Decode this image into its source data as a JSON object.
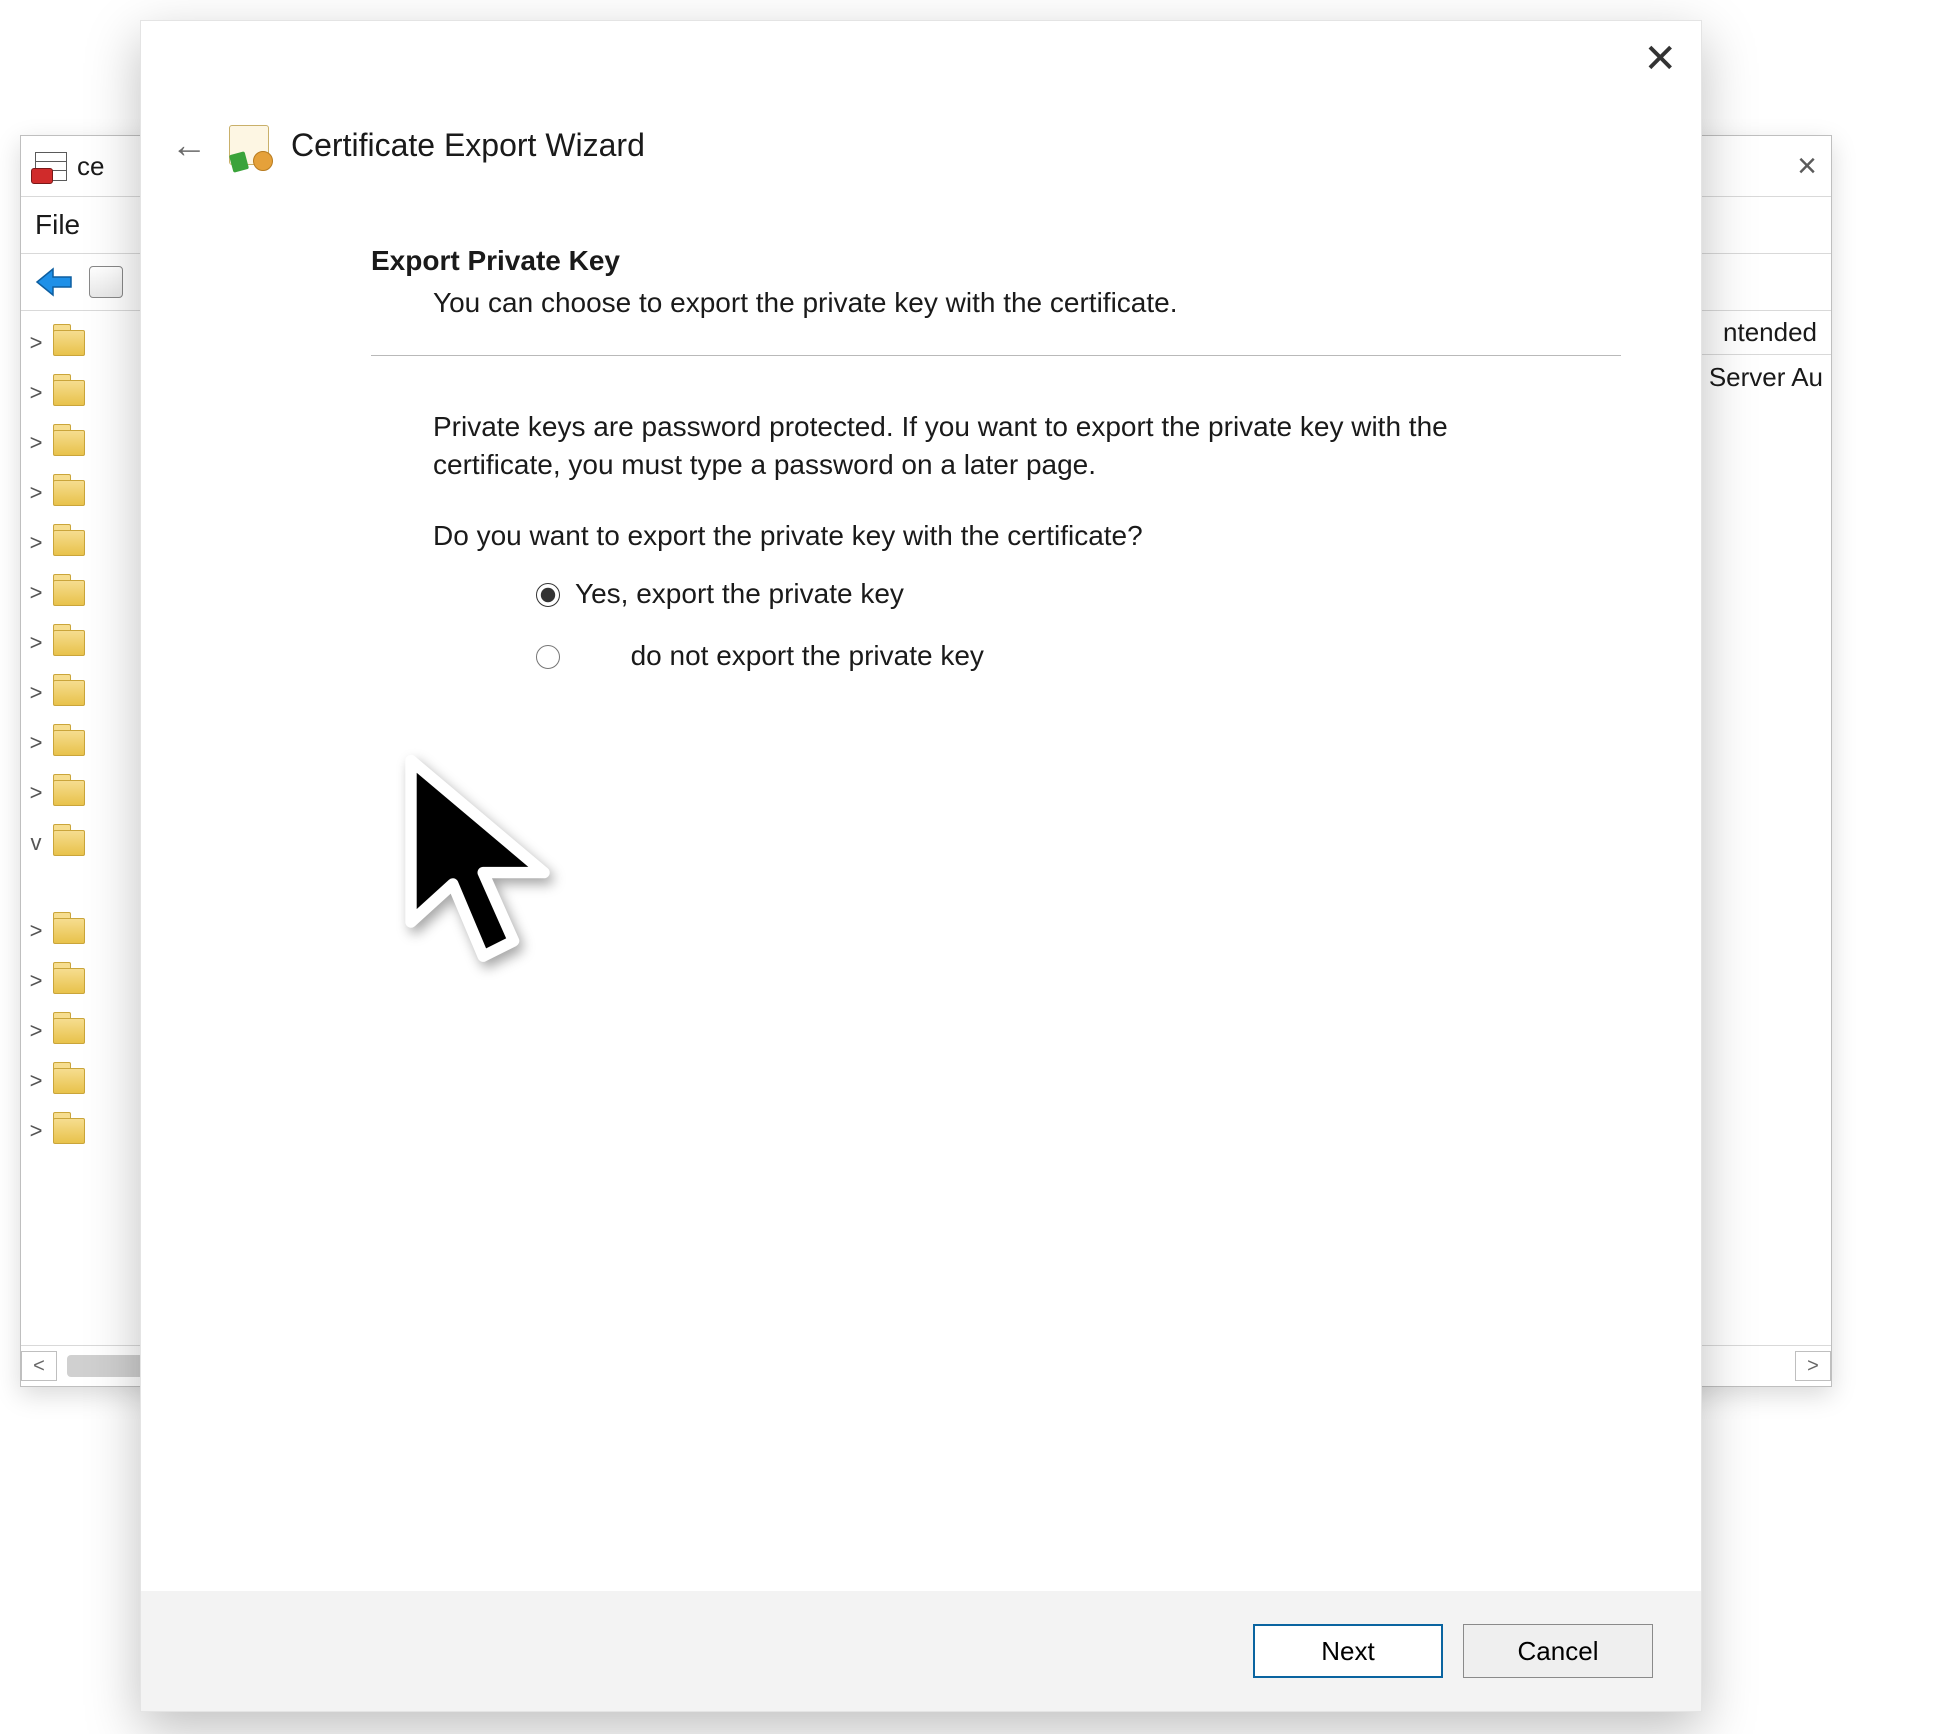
{
  "mmc": {
    "title_partial": "ce",
    "menu": {
      "file": "File"
    },
    "tree_items": [
      {
        "expander": ">"
      },
      {
        "expander": ">"
      },
      {
        "expander": ">"
      },
      {
        "expander": ">"
      },
      {
        "expander": ">"
      },
      {
        "expander": ">"
      },
      {
        "expander": ">"
      },
      {
        "expander": ">"
      },
      {
        "expander": ">"
      },
      {
        "expander": ">"
      },
      {
        "expander": "v"
      }
    ],
    "tree_items2": [
      {
        "expander": ">"
      },
      {
        "expander": ">"
      },
      {
        "expander": ">"
      },
      {
        "expander": ">"
      },
      {
        "expander": ">"
      }
    ],
    "list_header_partial": "ntended",
    "list_row_partial": "Server Au",
    "scroll_left": "<",
    "scroll_right": ">"
  },
  "wizard": {
    "title": "Certificate Export Wizard",
    "section_title": "Export Private Key",
    "section_sub": "You can choose to export the private key with the certificate.",
    "paragraph": "Private keys are password protected. If you want to export the private key with the certificate, you must type a password on a later page.",
    "question": "Do you want to export the private key with the certificate?",
    "option_yes": "Yes, export the private key",
    "option_no_partial": "do not export the private key",
    "selected": "yes",
    "next": "Next",
    "cancel": "Cancel"
  }
}
